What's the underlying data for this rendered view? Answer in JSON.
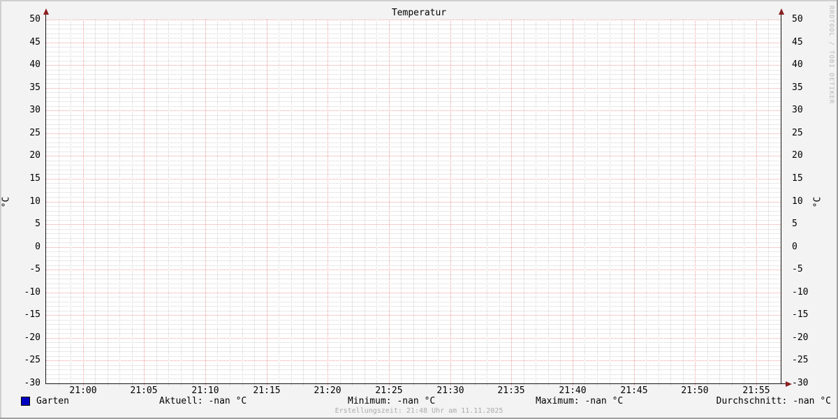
{
  "title": "Temperatur",
  "watermark": "RRDTOOL / TOBI OETIKER",
  "footer": "Erstellungszeit: 21:48 Uhr am 11.11.2025",
  "axes": {
    "y_left_unit": "°C",
    "y_right_unit": "°C",
    "y_ticks": [
      "50",
      "45",
      "40",
      "35",
      "30",
      "25",
      "20",
      "15",
      "10",
      "5",
      "0",
      "-5",
      "-10",
      "-15",
      "-20",
      "-25",
      "-30"
    ],
    "x_ticks": [
      "21:00",
      "21:05",
      "21:10",
      "21:15",
      "21:20",
      "21:25",
      "21:30",
      "21:35",
      "21:40",
      "21:45",
      "21:50",
      "21:55"
    ]
  },
  "legend": {
    "series": {
      "label": "Garten",
      "color": "#0000c0"
    },
    "stats": [
      {
        "label": "Aktuell:",
        "value": "-nan °C"
      },
      {
        "label": "Minimum:",
        "value": "-nan °C"
      },
      {
        "label": "Maximum:",
        "value": "-nan °C"
      },
      {
        "label": "Durchschnitt:",
        "value": "-nan °C"
      }
    ]
  },
  "colors": {
    "background": "#f3f3f3",
    "canvas": "#ffffff",
    "major_grid": "#ee9c9c",
    "minor_grid": "#d2d2d2",
    "axis": "#161616",
    "arrow": "#8a1f1f",
    "series": "#0000c0",
    "watermark_text": "#b8b8b8",
    "footer_text": "#ababab"
  },
  "chart_data": {
    "type": "line",
    "title": "Temperatur",
    "xlabel": "",
    "ylabel": "°C",
    "ylim": [
      -30,
      50
    ],
    "y_major_step": 5,
    "y_minor_step": 1,
    "x_range_minutes": [
      "20:57",
      "21:57"
    ],
    "x_tick_labels": [
      "21:00",
      "21:05",
      "21:10",
      "21:15",
      "21:20",
      "21:25",
      "21:30",
      "21:35",
      "21:40",
      "21:45",
      "21:50",
      "21:55"
    ],
    "x_minor_step_minutes": 1,
    "x_major_step_minutes": 5,
    "grid": true,
    "legend_position": "bottom",
    "series": [
      {
        "name": "Garten",
        "color": "#0000c0",
        "x": [],
        "values": [],
        "note": "no data plotted; all statistics are -nan"
      }
    ],
    "stats": {
      "aktuell": "-nan °C",
      "minimum": "-nan °C",
      "maximum": "-nan °C",
      "durchschnitt": "-nan °C"
    }
  }
}
